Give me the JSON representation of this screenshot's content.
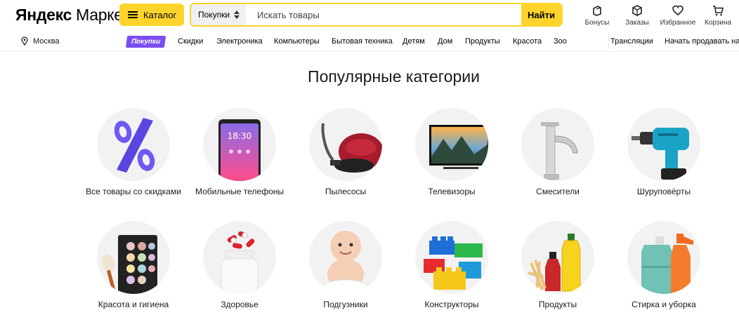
{
  "header": {
    "logo_bold": "Яндекс",
    "logo_light": "Маркет",
    "catalog_label": "Каталог",
    "search_scope": "Покупки",
    "search_placeholder": "Искать товары",
    "search_button": "Найти",
    "actions": [
      {
        "label": "Бонусы",
        "icon": "bonus-icon"
      },
      {
        "label": "Заказы",
        "icon": "box-icon"
      },
      {
        "label": "Избранное",
        "icon": "heart-icon"
      },
      {
        "label": "Корзина",
        "icon": "cart-icon"
      }
    ]
  },
  "nav": {
    "city": "Москва",
    "badge": "Покупки",
    "links": [
      "Скидки",
      "Электроника",
      "Компьютеры",
      "Бытовая техника",
      "Детям",
      "Дом",
      "Продукты",
      "Красота",
      "Зоо"
    ],
    "right_links": [
      "Трансляции",
      "Начать продавать на Маркете"
    ]
  },
  "main": {
    "title": "Популярные категории",
    "categories": [
      {
        "label": "Все товары со скидками",
        "icon": "percent-icon"
      },
      {
        "label": "Мобильные телефоны",
        "icon": "phone-icon"
      },
      {
        "label": "Пылесосы",
        "icon": "vacuum-icon"
      },
      {
        "label": "Телевизоры",
        "icon": "tv-icon"
      },
      {
        "label": "Смесители",
        "icon": "faucet-icon"
      },
      {
        "label": "Шуруповёрты",
        "icon": "drill-icon"
      },
      {
        "label": "Красота и гигиена",
        "icon": "palette-icon"
      },
      {
        "label": "Здоровье",
        "icon": "pills-icon"
      },
      {
        "label": "Подгузники",
        "icon": "baby-icon"
      },
      {
        "label": "Конструкторы",
        "icon": "blocks-icon"
      },
      {
        "label": "Продукты",
        "icon": "groceries-icon"
      },
      {
        "label": "Стирка и уборка",
        "icon": "detergent-icon"
      }
    ]
  },
  "colors": {
    "accent": "#fed42b",
    "badge": "#7b4df2",
    "circle_bg": "#f2f2f2"
  }
}
